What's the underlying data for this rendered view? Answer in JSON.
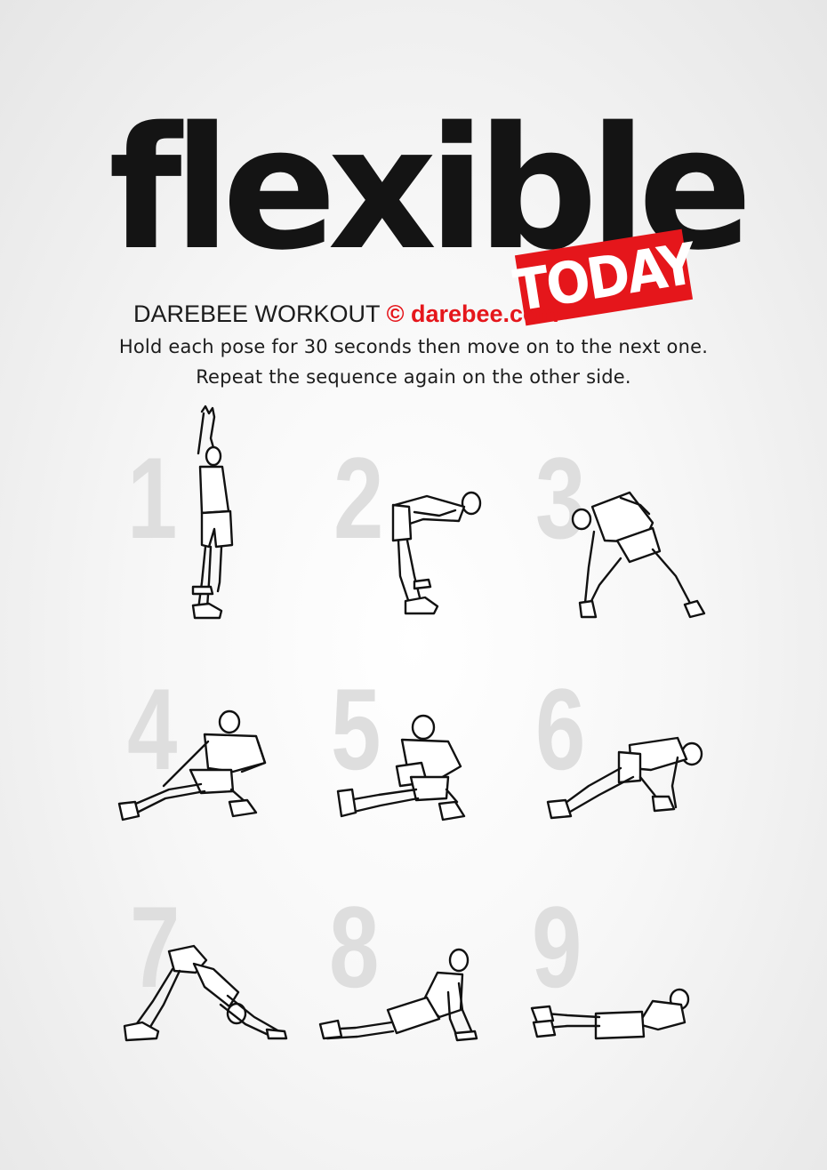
{
  "header": {
    "title": "flexible",
    "badge": "TODAY",
    "brand_label": "DAREBEE WORKOUT",
    "copyright_symbol": "©",
    "site": "darebee.com"
  },
  "instructions": [
    "Hold each pose for 30 seconds then move on to the next one.",
    "Repeat the sequence again on the other side."
  ],
  "exercises": [
    {
      "number": "1"
    },
    {
      "number": "2"
    },
    {
      "number": "3"
    },
    {
      "number": "4"
    },
    {
      "number": "5"
    },
    {
      "number": "6"
    },
    {
      "number": "7"
    },
    {
      "number": "8"
    },
    {
      "number": "9"
    }
  ],
  "colors": {
    "accent": "#e5161b",
    "title": "#141414",
    "numbers": "#dedede"
  }
}
